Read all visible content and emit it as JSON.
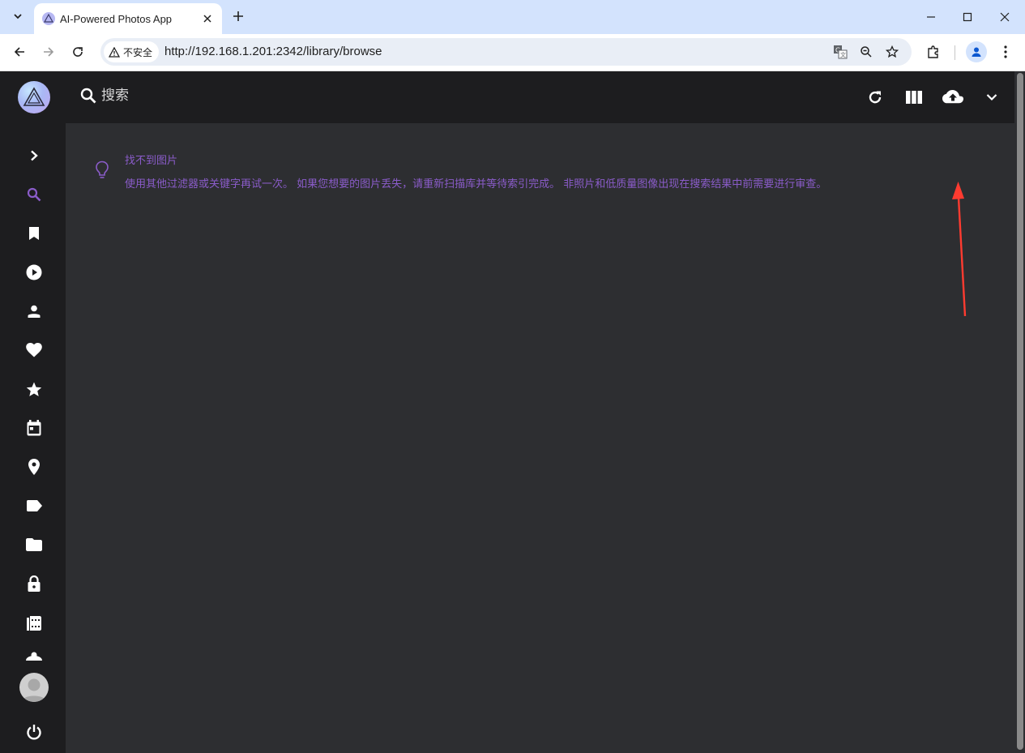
{
  "browser": {
    "tab_title": "AI-Powered Photos App",
    "security_label": "不安全",
    "url": "http://192.168.1.201:2342/library/browse"
  },
  "app": {
    "search_placeholder": "搜索",
    "empty_state": {
      "title": "找不到图片",
      "description": "使用其他过滤器或关键字再试一次。 如果您想要的图片丢失，请重新扫描库并等待索引完成。 非照片和低质量图像出现在搜索结果中前需要进行审查。"
    },
    "sidebar_items": [
      "expand-icon",
      "search-icon",
      "bookmark-icon",
      "video-icon",
      "person-icon",
      "heart-icon",
      "star-icon",
      "calendar-icon",
      "place-icon",
      "label-icon",
      "folder-icon",
      "lock-icon",
      "library-icon",
      "more-icon"
    ],
    "accent_color": "#8a5cc9",
    "annotation_color": "#ff3b30"
  }
}
